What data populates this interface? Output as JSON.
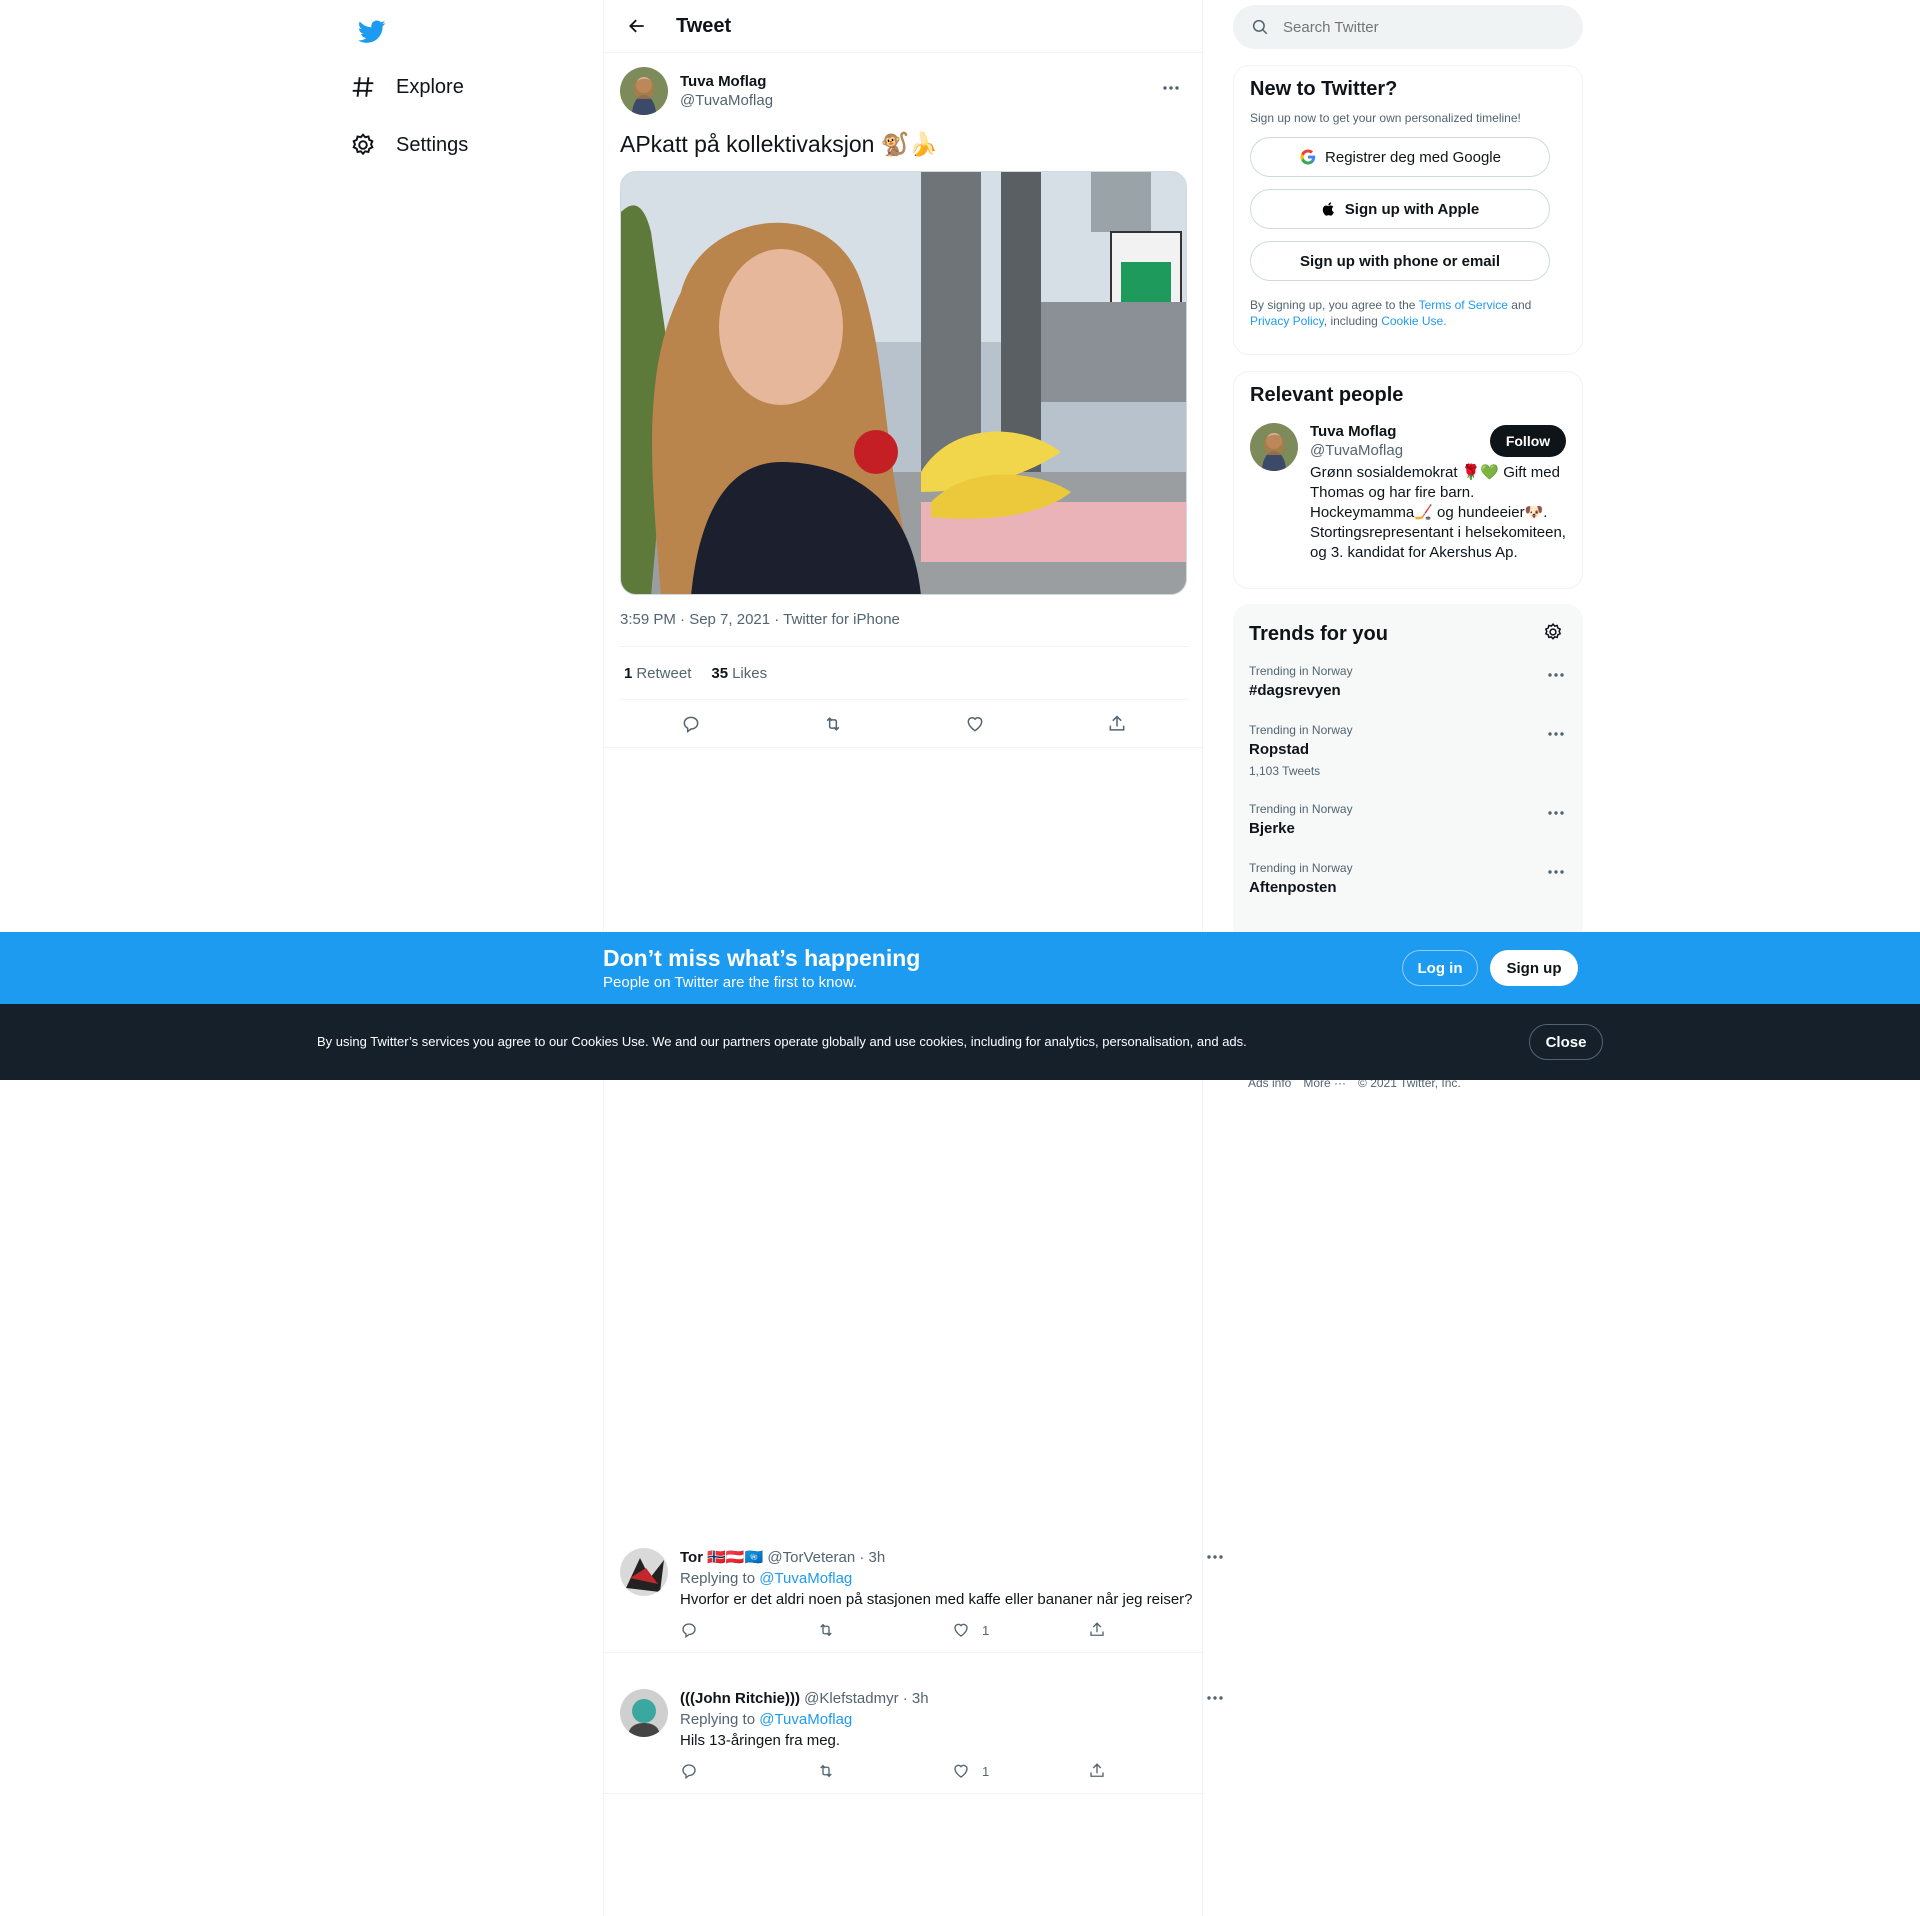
{
  "nav": {
    "explore": "Explore",
    "settings": "Settings"
  },
  "header": {
    "title": "Tweet"
  },
  "tweet": {
    "author_name": "Tuva Moflag",
    "author_handle": "@TuvaMoflag",
    "text": "APkatt på kollektivaksjon 🐒🍌",
    "meta": "3:59 PM · Sep 7, 2021 · Twitter for iPhone",
    "retweets_count": "1",
    "retweets_label": "Retweet",
    "likes_count": "35",
    "likes_label": "Likes"
  },
  "replies": [
    {
      "name": "Tor 🇳🇴🇦🇹🇺🇳",
      "handle": "@TorVeteran · 3h",
      "replying_prefix": "Replying to",
      "replying_to": "@TuvaMoflag",
      "text": "Hvorfor er det aldri noen på stasjonen med kaffe eller bananer når jeg reiser?",
      "likes": "1"
    },
    {
      "name": "(((John Ritchie)))",
      "handle": "@Klefstadmyr · 3h",
      "replying_prefix": "Replying to",
      "replying_to": "@TuvaMoflag",
      "text": "Hils 13-åringen fra meg.",
      "likes": "1"
    }
  ],
  "search": {
    "placeholder": "Search Twitter"
  },
  "new_to_twitter": {
    "title": "New to Twitter?",
    "subtitle": "Sign up now to get your own personalized timeline!",
    "google": "Registrer deg med Google",
    "apple": "Sign up with Apple",
    "phone": "Sign up with phone or email",
    "legal_1": "By signing up, you agree to the",
    "terms": "Terms of Service",
    "legal_2": "and",
    "privacy": "Privacy Policy",
    "legal_3": ", including",
    "cookie": "Cookie Use."
  },
  "relevant": {
    "title": "Relevant people",
    "name": "Tuva Moflag",
    "handle": "@TuvaMoflag",
    "follow": "Follow",
    "bio": "Grønn sosialdemokrat 🌹💚 Gift med Thomas og har fire barn. Hockeymamma🏒 og hundeeier🐶. Stortingsrepresentant i helsekomiteen, og 3. kandidat for Akershus Ap."
  },
  "trends": {
    "title": "Trends for you",
    "items": [
      {
        "category": "Trending in Norway",
        "topic": "#dagsrevyen",
        "count": ""
      },
      {
        "category": "Trending in Norway",
        "topic": "Ropstad",
        "count": "1,103 Tweets"
      },
      {
        "category": "Trending in Norway",
        "topic": "Bjerke",
        "count": ""
      },
      {
        "category": "Trending in Norway",
        "topic": "Aftenposten",
        "count": ""
      }
    ]
  },
  "footer": {
    "ads_info": "Ads info",
    "more": "More ···",
    "copyright": "© 2021 Twitter, Inc."
  },
  "banner": {
    "title": "Don’t miss what’s happening",
    "subtitle": "People on Twitter are the first to know.",
    "login": "Log in",
    "signup": "Sign up"
  },
  "cookie_bar": {
    "text": "By using Twitter’s services you agree to our Cookies Use. We and our partners operate globally and use cookies, including for analytics, personalisation, and ads.",
    "close": "Close"
  },
  "colors": {
    "accent": "#1d9bf0",
    "text": "#0f1419",
    "muted": "#536471",
    "cookie_bg": "#15202b"
  }
}
